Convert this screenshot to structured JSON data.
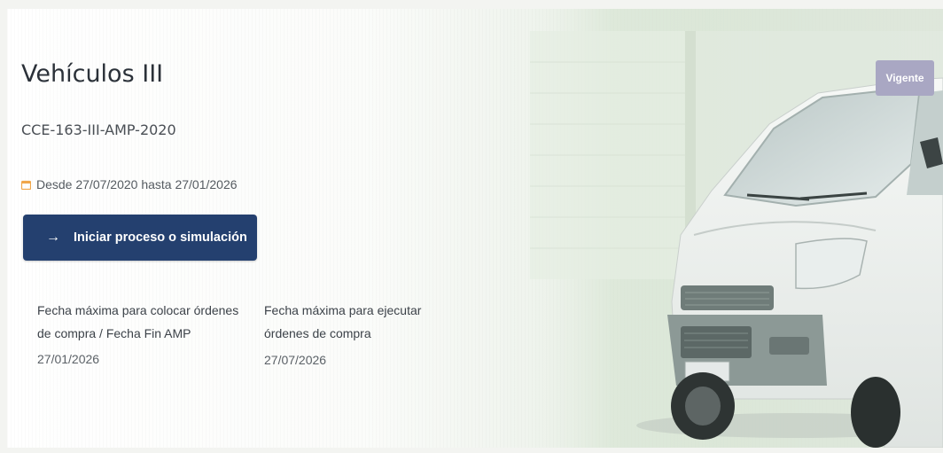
{
  "card": {
    "title": "Vehículos III",
    "code": "CCE-163-III-AMP-2020",
    "validity": "Desde 27/07/2020 hasta 27/01/2026",
    "status_badge": "Vigente",
    "primary_button": {
      "icon": "arrow-right-icon",
      "label": "Iniciar proceso o simulación"
    },
    "info": [
      {
        "label": "Fecha máxima para colocar órdenes de compra / Fecha Fin AMP",
        "value": "27/01/2026"
      },
      {
        "label": "Fecha máxima para ejecutar órdenes de compra",
        "value": "27/07/2026"
      }
    ]
  },
  "colors": {
    "primary_button": "#24406f",
    "badge": "#a9a7c3",
    "calendar_icon": "#f0a64a",
    "title_text": "#2b3139"
  }
}
